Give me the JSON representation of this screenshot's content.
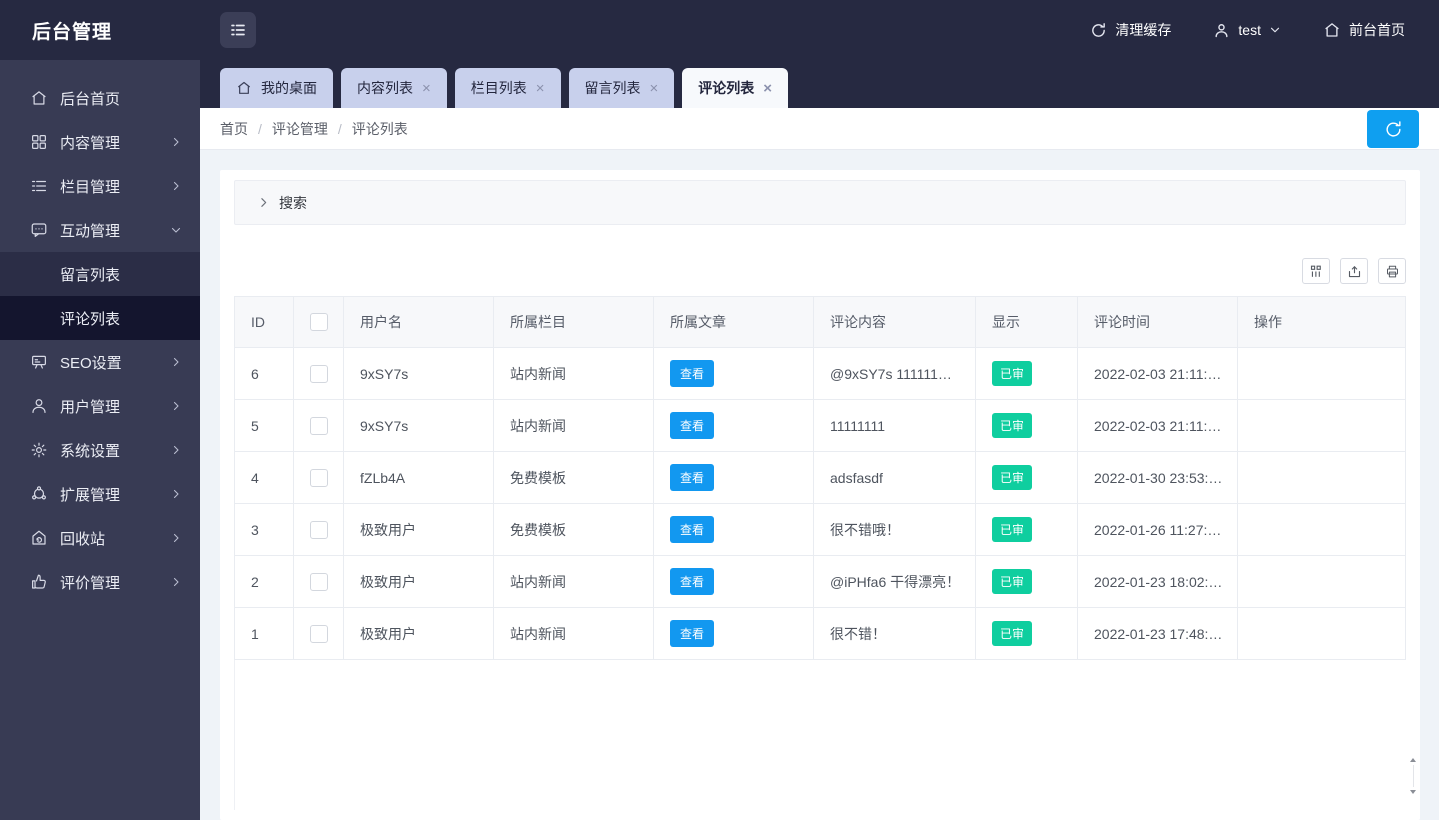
{
  "topbar": {
    "title": "后台管理",
    "clear_cache_label": "清理缓存",
    "username": "test",
    "front_home_label": "前台首页"
  },
  "ui": {
    "close_glyph": "×"
  },
  "sidebar": {
    "items": [
      {
        "label": "后台首页",
        "icon": "home-icon"
      },
      {
        "label": "内容管理",
        "icon": "grid-icon"
      },
      {
        "label": "栏目管理",
        "icon": "list-icon"
      },
      {
        "label": "互动管理",
        "icon": "chat-icon"
      },
      {
        "label": "SEO设置",
        "icon": "presentation-icon"
      },
      {
        "label": "用户管理",
        "icon": "user-icon"
      },
      {
        "label": "系统设置",
        "icon": "gear-icon"
      },
      {
        "label": "扩展管理",
        "icon": "nodes-icon"
      },
      {
        "label": "回收站",
        "icon": "recycle-icon"
      },
      {
        "label": "评价管理",
        "icon": "thumbs-up-icon"
      }
    ],
    "submenu": [
      {
        "label": "留言列表",
        "active": false
      },
      {
        "label": "评论列表",
        "active": true
      }
    ]
  },
  "tabs": [
    {
      "label": "我的桌面",
      "closable": false,
      "active": false
    },
    {
      "label": "内容列表",
      "closable": true,
      "active": false
    },
    {
      "label": "栏目列表",
      "closable": true,
      "active": false
    },
    {
      "label": "留言列表",
      "closable": true,
      "active": false
    },
    {
      "label": "评论列表",
      "closable": true,
      "active": true
    }
  ],
  "breadcrumb": {
    "items": [
      "首页",
      "评论管理",
      "评论列表"
    ],
    "separator": "/"
  },
  "search_panel": {
    "label": "搜索"
  },
  "toolbar": {
    "buttons": [
      "columns-icon",
      "export-icon",
      "print-icon"
    ]
  },
  "table": {
    "headers": [
      "ID",
      "用户名",
      "所属栏目",
      "所属文章",
      "评论内容",
      "显示",
      "评论时间",
      "操作"
    ],
    "view_button_label": "查看",
    "rows": [
      {
        "id": "6",
        "username": "9xSY7s",
        "category": "站内新闻",
        "content": "@9xSY7s 111111…",
        "status": "已审",
        "time": "2022-02-03 21:11:…"
      },
      {
        "id": "5",
        "username": "9xSY7s",
        "category": "站内新闻",
        "content": "11111111",
        "status": "已审",
        "time": "2022-02-03 21:11:…"
      },
      {
        "id": "4",
        "username": "fZLb4A",
        "category": "免费模板",
        "content": "adsfasdf",
        "status": "已审",
        "time": "2022-01-30 23:53:…"
      },
      {
        "id": "3",
        "username": "极致用户",
        "category": "免费模板",
        "content": "很不错哦！",
        "status": "已审",
        "time": "2022-01-26 11:27:…"
      },
      {
        "id": "2",
        "username": "极致用户",
        "category": "站内新闻",
        "content": "@iPHfa6 干得漂亮！",
        "status": "已审",
        "time": "2022-01-23 18:02:…"
      },
      {
        "id": "1",
        "username": "极致用户",
        "category": "站内新闻",
        "content": "很不错！",
        "status": "已审",
        "time": "2022-01-23 17:48:…"
      }
    ]
  },
  "colors": {
    "topbar_navy": "#262941",
    "sidebar_navy": "#383b54",
    "submenu_dark": "#2b2d46",
    "submenu_active": "#14152e",
    "tab_inactive": "#c8d0ec",
    "accent_blue": "#1298f0",
    "refresh_blue": "#0f9ff0",
    "badge_teal": "#0fce9f",
    "content_bg": "#eff3f8"
  }
}
